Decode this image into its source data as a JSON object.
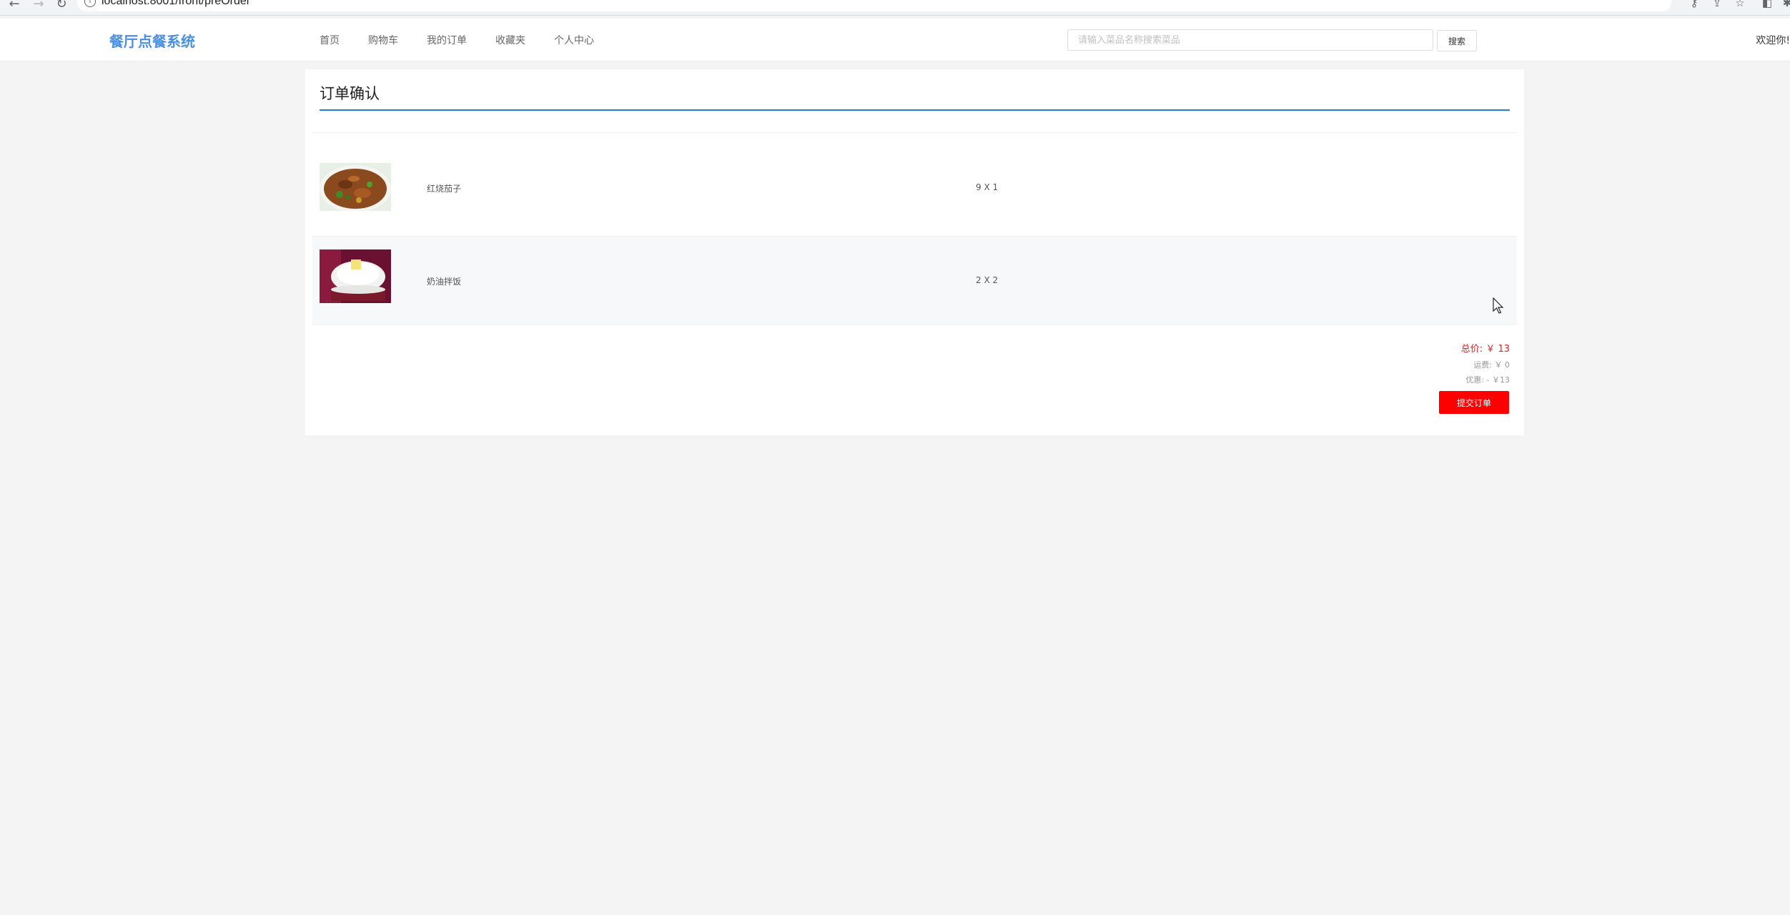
{
  "browser": {
    "url": "localhost:8001/front/preOrder"
  },
  "header": {
    "logo": "餐厅点餐系统",
    "nav": [
      "首页",
      "购物车",
      "我的订单",
      "收藏夹",
      "个人中心"
    ],
    "search_placeholder": "请输入菜品名称搜索菜品",
    "search_button": "搜索",
    "welcome": "欢迎你!"
  },
  "order": {
    "title": "订单确认",
    "items": [
      {
        "name": "红烧茄子",
        "qty": "9 X 1"
      },
      {
        "name": "奶油拌饭",
        "qty": "2 X 2"
      }
    ],
    "total_label": "总价:",
    "total_value": "￥ 13",
    "shipping_label": "运费:",
    "shipping_value": "￥ 0",
    "discount_label": "优惠:",
    "discount_value": "- ￥13",
    "submit_label": "提交订单"
  },
  "colors": {
    "logo": "#4b8fe0",
    "title_rule": "#1e7fcc",
    "total": "#e02020",
    "submit": "#ff0000"
  }
}
